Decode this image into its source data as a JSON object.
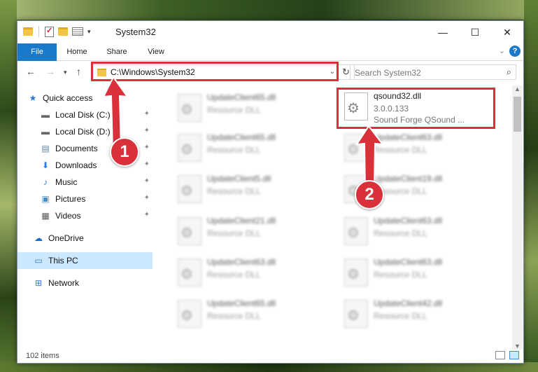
{
  "window": {
    "title": "System32",
    "controls": {
      "minimize": "—",
      "maximize": "☐",
      "close": "✕"
    }
  },
  "ribbon": {
    "tabs": [
      "File",
      "Home",
      "Share",
      "View"
    ],
    "help": "?"
  },
  "address_bar": {
    "path": "C:\\Windows\\System32",
    "search_placeholder": "Search System32"
  },
  "nav_pane": {
    "items": [
      {
        "label": "Quick access",
        "icon": "star-icon"
      },
      {
        "label": "Local Disk (C:)",
        "icon": "drive-icon",
        "pinned": true
      },
      {
        "label": "Local Disk (D:)",
        "icon": "drive-icon",
        "pinned": true
      },
      {
        "label": "Documents",
        "icon": "documents-icon",
        "pinned": true
      },
      {
        "label": "Downloads",
        "icon": "download-icon",
        "pinned": true
      },
      {
        "label": "Music",
        "icon": "music-icon",
        "pinned": true
      },
      {
        "label": "Pictures",
        "icon": "pictures-icon",
        "pinned": true
      },
      {
        "label": "Videos",
        "icon": "videos-icon",
        "pinned": true
      },
      {
        "label": "OneDrive",
        "icon": "cloud-icon"
      },
      {
        "label": "This PC",
        "icon": "computer-icon",
        "selected": true
      },
      {
        "label": "Network",
        "icon": "network-icon"
      }
    ]
  },
  "files": {
    "highlighted": {
      "name": "qsound32.dll",
      "version": "3.0.0.133",
      "description": "Sound Forge QSound ..."
    },
    "left_column": [
      {
        "name": "UpdateClient65.dll",
        "type": "Resource DLL"
      },
      {
        "name": "UpdateClient65.dll",
        "type": "Resource DLL"
      },
      {
        "name": "UpdateClient5.dll",
        "type": "Resource DLL"
      },
      {
        "name": "UpdateClient21.dll",
        "type": "Resource DLL"
      },
      {
        "name": "UpdateClient63.dll",
        "type": "Resource DLL"
      },
      {
        "name": "UpdateClient65.dll",
        "type": "Resource DLL"
      }
    ],
    "right_column": [
      {
        "name": "UpdateClient63.dll",
        "type": "Resource DLL"
      },
      {
        "name": "UpdateClient19.dll",
        "type": "Resource DLL"
      },
      {
        "name": "UpdateClient63.dll",
        "type": "Resource DLL"
      },
      {
        "name": "UpdateClient63.dll",
        "type": "Resource DLL"
      },
      {
        "name": "UpdateClient42.dll",
        "type": "Resource DLL"
      }
    ]
  },
  "status": {
    "item_count": "102 items"
  },
  "annotations": {
    "step1": "1",
    "step2": "2",
    "color": "#d9303a"
  }
}
